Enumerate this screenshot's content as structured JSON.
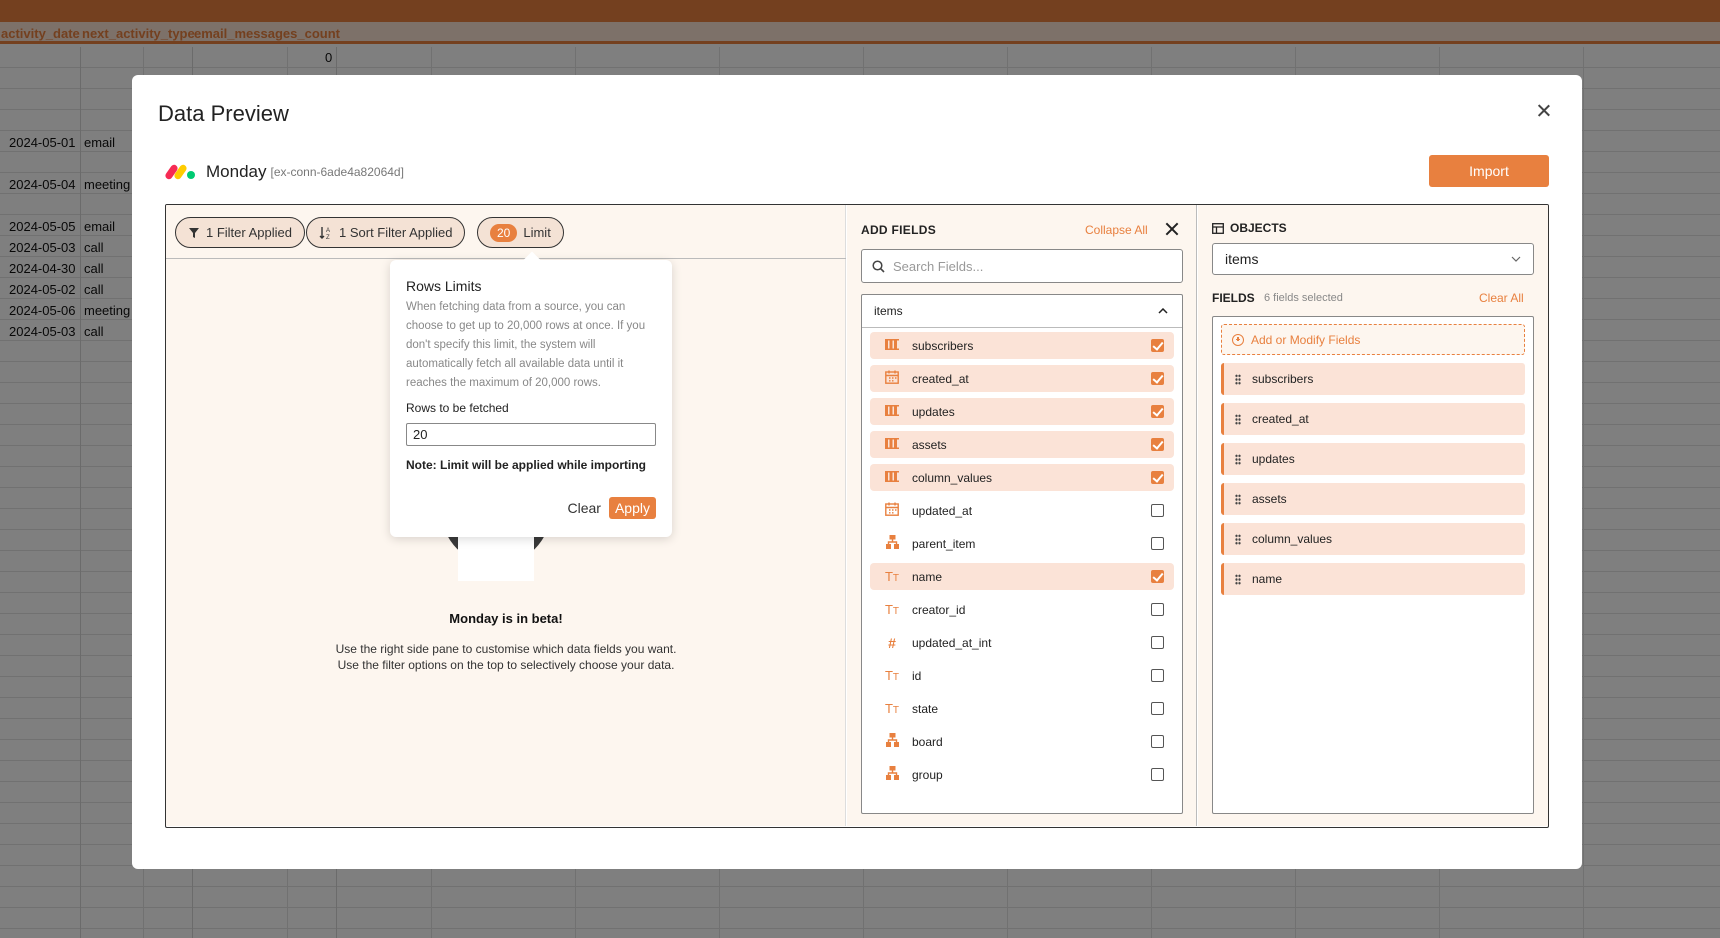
{
  "sheet": {
    "headers": [
      "activity_date",
      "next_activity_type",
      "email_messages_count"
    ],
    "rows": [
      {
        "count": "0"
      },
      {
        "date": "2024-05-01",
        "type": "email"
      },
      {
        "date": "2024-05-04",
        "type": "meeting"
      },
      {
        "date": "2024-05-05",
        "type": "email"
      },
      {
        "date": "2024-05-03",
        "type": "call"
      },
      {
        "date": "2024-04-30",
        "type": "call"
      },
      {
        "date": "2024-05-02",
        "type": "call"
      },
      {
        "date": "2024-05-06",
        "type": "meeting"
      },
      {
        "date": "2024-05-03",
        "type": "call"
      }
    ]
  },
  "modal": {
    "title": "Data Preview",
    "source_name": "Monday",
    "source_id": "[ex-conn-6ade4a82064d]",
    "import_label": "Import"
  },
  "toolbar": {
    "filter_label": "1 Filter Applied",
    "sort_label": "1 Sort Filter Applied",
    "limit_badge": "20",
    "limit_label": "Limit"
  },
  "popover": {
    "title": "Rows Limits",
    "description": "When fetching data from a source, you can choose to get up to 20,000 rows at once. If you don't specify this limit, the system will automatically fetch all available data until it reaches the maximum of 20,000 rows.",
    "rows_label": "Rows to be fetched",
    "rows_value": "20",
    "note": "Note: Limit will be applied while importing",
    "clear_label": "Clear",
    "apply_label": "Apply"
  },
  "empty_state": {
    "title": "Monday is in beta!",
    "line1": "Use the right side pane to customise which data fields you want.",
    "line2": "Use the filter options on the top to selectively choose your data."
  },
  "add_fields": {
    "title": "ADD FIELDS",
    "collapse_label": "Collapse All",
    "search_placeholder": "Search Fields...",
    "group_name": "items",
    "fields": [
      {
        "name": "subscribers",
        "icon": "columns-icon",
        "checked": true
      },
      {
        "name": "created_at",
        "icon": "calendar-icon",
        "checked": true
      },
      {
        "name": "updates",
        "icon": "columns-icon",
        "checked": true
      },
      {
        "name": "assets",
        "icon": "columns-icon",
        "checked": true
      },
      {
        "name": "column_values",
        "icon": "columns-icon",
        "checked": true
      },
      {
        "name": "updated_at",
        "icon": "calendar-icon",
        "checked": false
      },
      {
        "name": "parent_item",
        "icon": "hierarchy-icon",
        "checked": false
      },
      {
        "name": "name",
        "icon": "text-icon",
        "checked": true
      },
      {
        "name": "creator_id",
        "icon": "text-icon",
        "checked": false
      },
      {
        "name": "updated_at_int",
        "icon": "hash-icon",
        "checked": false
      },
      {
        "name": "id",
        "icon": "text-icon",
        "checked": false
      },
      {
        "name": "state",
        "icon": "text-icon",
        "checked": false
      },
      {
        "name": "board",
        "icon": "hierarchy-icon",
        "checked": false
      },
      {
        "name": "group",
        "icon": "hierarchy-icon",
        "checked": false
      }
    ]
  },
  "objects": {
    "title": "OBJECTS",
    "selected": "items",
    "fields_label": "FIELDS",
    "fields_count": "6 fields selected",
    "clear_all_label": "Clear All",
    "add_label": "Add or Modify Fields",
    "selected_fields": [
      "subscribers",
      "created_at",
      "updates",
      "assets",
      "column_values",
      "name"
    ]
  },
  "colors": {
    "accent": "#e8803f",
    "accent_light": "#fbe3d7",
    "pane_bg": "#fdf6ef"
  }
}
